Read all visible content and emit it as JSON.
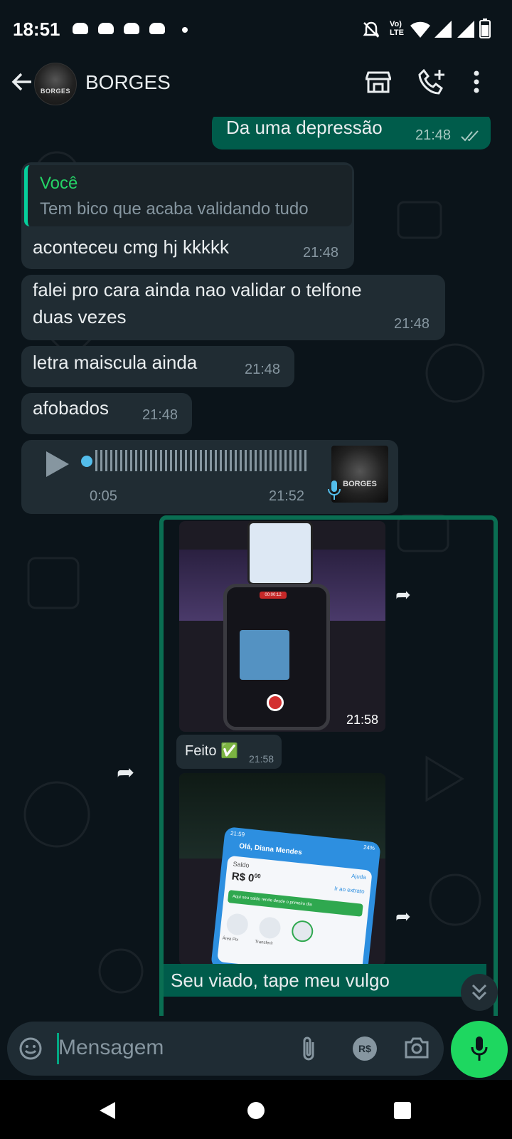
{
  "status_bar": {
    "time": "18:51",
    "lte_top": "Vo)",
    "lte_bottom": "LTE"
  },
  "header": {
    "contact_name": "BORGES",
    "avatar_text": "BORGES"
  },
  "messages": [
    {
      "text": "Da uma depressão",
      "time": "21:48"
    },
    {
      "quote_author": "Você",
      "quote_text": "Tem bico que acaba validando tudo",
      "text": "aconteceu cmg hj kkkkk",
      "time": "21:48"
    },
    {
      "text_line1": "falei pro cara ainda nao validar o telfone",
      "text_line2": "duas vezes",
      "time": "21:48"
    },
    {
      "text": "letra maiscula ainda",
      "time": "21:48"
    },
    {
      "text": "afobados",
      "time": "21:48"
    }
  ],
  "voice_note": {
    "duration": "0:05",
    "time": "21:52",
    "avatar_text": "BORGES"
  },
  "forwarded": {
    "photo1": {
      "time": "21:58",
      "recording_label": "00:00:12"
    },
    "caption": {
      "text": "Feito ✅",
      "time": "21:58"
    },
    "photo2": {
      "greeting": "Olá, Diana Mendes",
      "saldo_label": "Saldo",
      "saldo_value": "R$ 0",
      "saldo_cents": "00",
      "help": "Ajuda",
      "extrato": "Ir ao extrato",
      "banner": "Aqui seu saldo rende desde o primeiro dia",
      "tile1": "Área Pix",
      "tile2": "Transferir",
      "phone_time": "21:59",
      "battery": "24%"
    },
    "bottom_text": "Seu viado, tape meu vulgo"
  },
  "input": {
    "placeholder": "Mensagem",
    "currency_label": "R$"
  },
  "colors": {
    "accent": "#1ed760",
    "outgoing": "#005c4b",
    "incoming": "#202c33",
    "background": "#0b141a"
  }
}
